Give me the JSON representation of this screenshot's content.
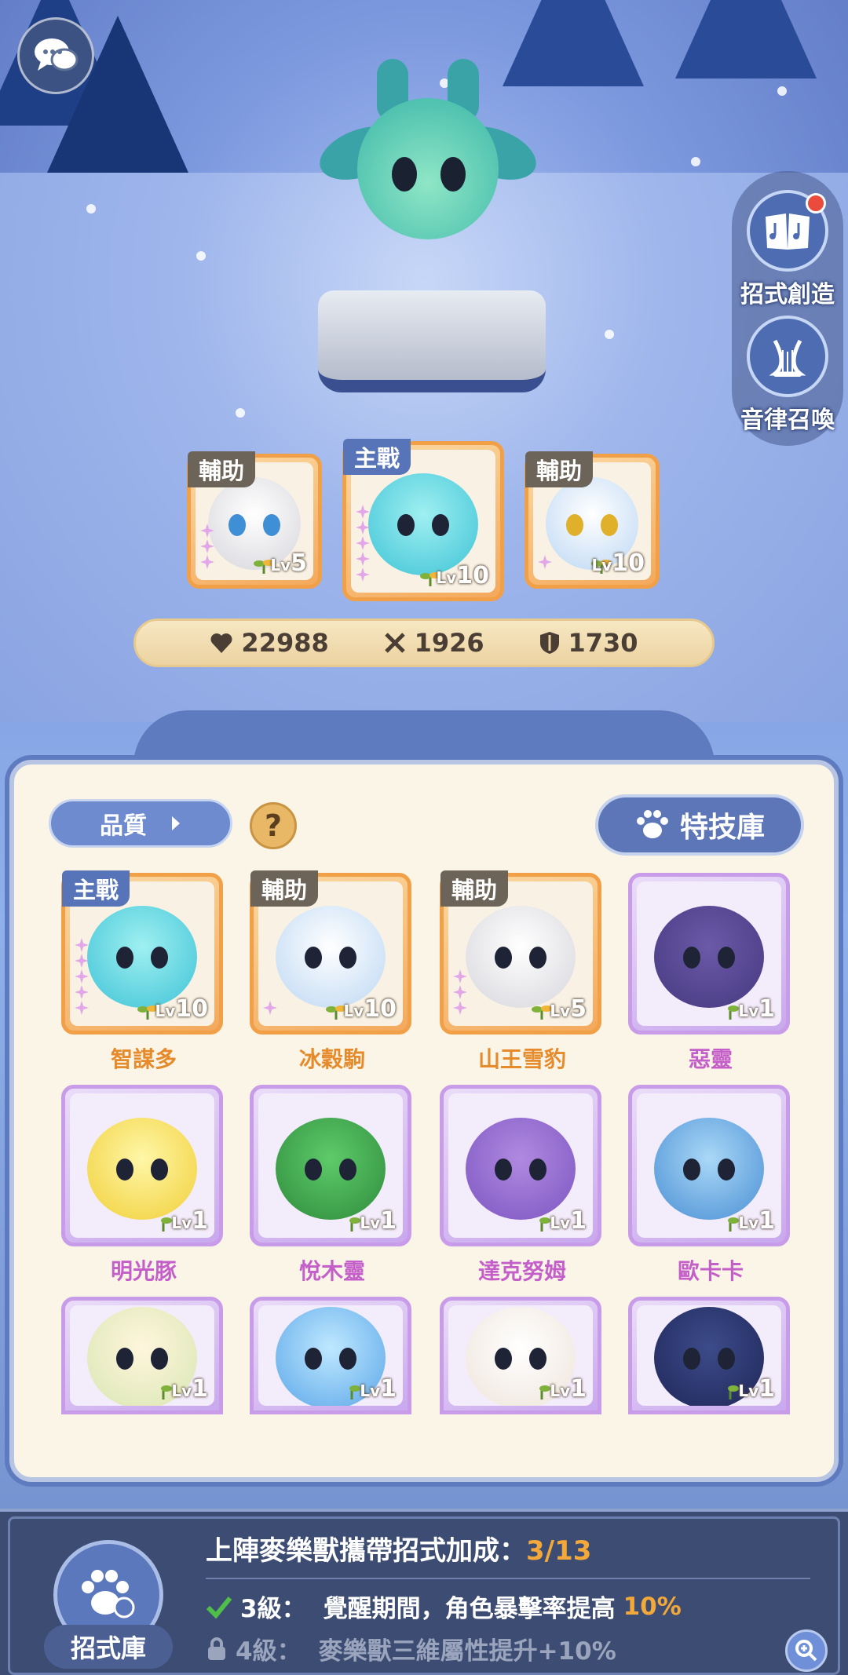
{
  "side_buttons": {
    "create_label": "招式創造",
    "summon_label": "音律召喚"
  },
  "team": [
    {
      "role": "輔助",
      "level": "5"
    },
    {
      "role": "主戰",
      "level": "10"
    },
    {
      "role": "輔助",
      "level": "10"
    }
  ],
  "stats": {
    "hp": "22988",
    "attack": "1926",
    "defense": "1730"
  },
  "filter": {
    "label": "品質",
    "help": "?"
  },
  "skill_library_btn": "特技庫",
  "level_prefix": "Lv",
  "pets": [
    {
      "name": "智謀多",
      "role": "主戰",
      "level": "10",
      "rarity": "orange",
      "name_color": "#e68b2c"
    },
    {
      "name": "冰穀駒",
      "role": "輔助",
      "level": "10",
      "rarity": "orange",
      "name_color": "#e68b2c"
    },
    {
      "name": "山王雪豹",
      "role": "輔助",
      "level": "5",
      "rarity": "orange",
      "name_color": "#e68b2c"
    },
    {
      "name": "惡靈",
      "role": "",
      "level": "1",
      "rarity": "purple",
      "name_color": "#c45fc9"
    },
    {
      "name": "明光豚",
      "role": "",
      "level": "1",
      "rarity": "purple",
      "name_color": "#c45fc9"
    },
    {
      "name": "悅木靈",
      "role": "",
      "level": "1",
      "rarity": "purple",
      "name_color": "#c45fc9"
    },
    {
      "name": "達克努姆",
      "role": "",
      "level": "1",
      "rarity": "purple",
      "name_color": "#c45fc9"
    },
    {
      "name": "歐卡卡",
      "role": "",
      "level": "1",
      "rarity": "purple",
      "name_color": "#c45fc9"
    },
    {
      "name": "",
      "role": "",
      "level": "1",
      "rarity": "purple",
      "name_color": "#c45fc9"
    },
    {
      "name": "",
      "role": "",
      "level": "1",
      "rarity": "purple",
      "name_color": "#c45fc9"
    },
    {
      "name": "",
      "role": "",
      "level": "1",
      "rarity": "purple",
      "name_color": "#c45fc9"
    },
    {
      "name": "",
      "role": "",
      "level": "1",
      "rarity": "purple",
      "name_color": "#c45fc9"
    }
  ],
  "bonus": {
    "title": "上陣麥樂獸攜帶招式加成：",
    "count": "3/13",
    "line1_level": "3級：",
    "line1_text": "覺醒期間，角色暴擊率提高",
    "line1_value": "10%",
    "line2_level": "4級：",
    "line2_text": "麥樂獸三維屬性提升+10%"
  },
  "skill_library_label": "招式庫",
  "colors": {
    "accent": "#5f7bc0",
    "gold": "#f3a83a",
    "orange_card": "#f1a048",
    "purple_card": "#c89ce8"
  }
}
